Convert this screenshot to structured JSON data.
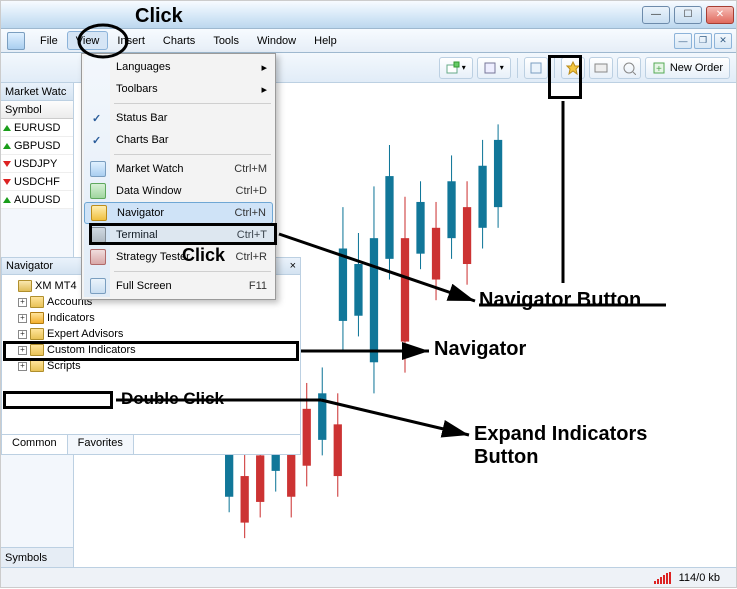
{
  "menubar": {
    "items": [
      "File",
      "View",
      "Insert",
      "Charts",
      "Tools",
      "Window",
      "Help"
    ]
  },
  "window_controls": {
    "min": "—",
    "max": "☐",
    "close": "✕"
  },
  "mdi_controls": {
    "min": "—",
    "restore": "❐",
    "close": "✕"
  },
  "toolbar": {
    "new_order_label": "New Order"
  },
  "market_watch": {
    "title": "Market Watc",
    "col_symbol": "Symbol",
    "rows": [
      {
        "arrow": "up",
        "symbol": "EURUSD"
      },
      {
        "arrow": "up",
        "symbol": "GBPUSD"
      },
      {
        "arrow": "down",
        "symbol": "USDJPY"
      },
      {
        "arrow": "down",
        "symbol": "USDCHF"
      },
      {
        "arrow": "up",
        "symbol": "AUDUSD"
      }
    ],
    "tab": "Symbols"
  },
  "view_menu": {
    "items": [
      {
        "label": "Languages",
        "arrow": true
      },
      {
        "label": "Toolbars",
        "arrow": true
      },
      {
        "sep": true
      },
      {
        "label": "Status Bar",
        "check": true
      },
      {
        "label": "Charts Bar",
        "check": true
      },
      {
        "sep": true
      },
      {
        "label": "Market Watch",
        "shortcut": "Ctrl+M",
        "icon": "ic-mw2"
      },
      {
        "label": "Data Window",
        "shortcut": "Ctrl+D",
        "icon": "ic-dw"
      },
      {
        "label": "Navigator",
        "shortcut": "Ctrl+N",
        "icon": "ic-nav",
        "highlight": true
      },
      {
        "label": "Terminal",
        "shortcut": "Ctrl+T",
        "icon": "ic-term"
      },
      {
        "label": "Strategy Tester",
        "shortcut": "Ctrl+R",
        "icon": "ic-st"
      },
      {
        "sep": true
      },
      {
        "label": "Full Screen",
        "shortcut": "F11",
        "icon": "ic-fs"
      }
    ]
  },
  "navigator": {
    "title": "Navigator",
    "close": "×",
    "tree": [
      {
        "label": "XM MT4",
        "icon": "ic-server",
        "exp": false
      },
      {
        "label": "Accounts",
        "icon": "ic-folder",
        "exp": true,
        "indent": 1
      },
      {
        "label": "Indicators",
        "icon": "ic-ind",
        "exp": true,
        "indent": 1
      },
      {
        "label": "Expert Advisors",
        "icon": "ic-folder",
        "exp": true,
        "indent": 1
      },
      {
        "label": "Custom Indicators",
        "icon": "ic-folder",
        "exp": true,
        "indent": 1
      },
      {
        "label": "Scripts",
        "icon": "ic-folder",
        "exp": true,
        "indent": 1
      }
    ],
    "tabs": [
      "Common",
      "Favorites"
    ]
  },
  "status": {
    "kb": "114/0 kb"
  },
  "annotations": {
    "click_view": "Click",
    "click_nav": "Click",
    "double_click": "Double Click",
    "nav_button": "Navigator Button",
    "nav_panel": "Navigator",
    "expand_ind": "Expand Indicators Button"
  }
}
